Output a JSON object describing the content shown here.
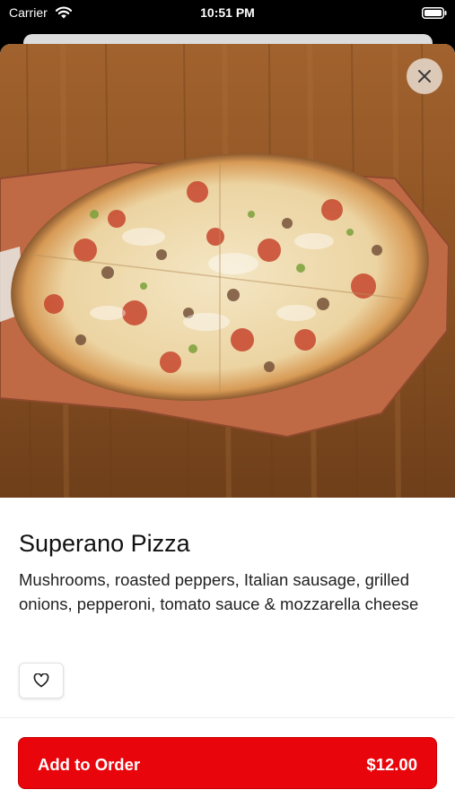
{
  "status_bar": {
    "carrier": "Carrier",
    "time": "10:51 PM"
  },
  "product": {
    "name": "Superano Pizza",
    "description": "Mushrooms, roasted peppers, Italian sausage, grilled onions, pepperoni, tomato sauce & mozzarella cheese"
  },
  "actions": {
    "add_label": "Add to Order",
    "price": "$12.00"
  },
  "icons": {
    "close": "close-icon",
    "favorite": "heart-icon",
    "wifi": "wifi-icon",
    "battery": "battery-icon"
  },
  "colors": {
    "accent": "#e8050b",
    "wood": "#9a5a28",
    "peel": "#c06a45"
  }
}
